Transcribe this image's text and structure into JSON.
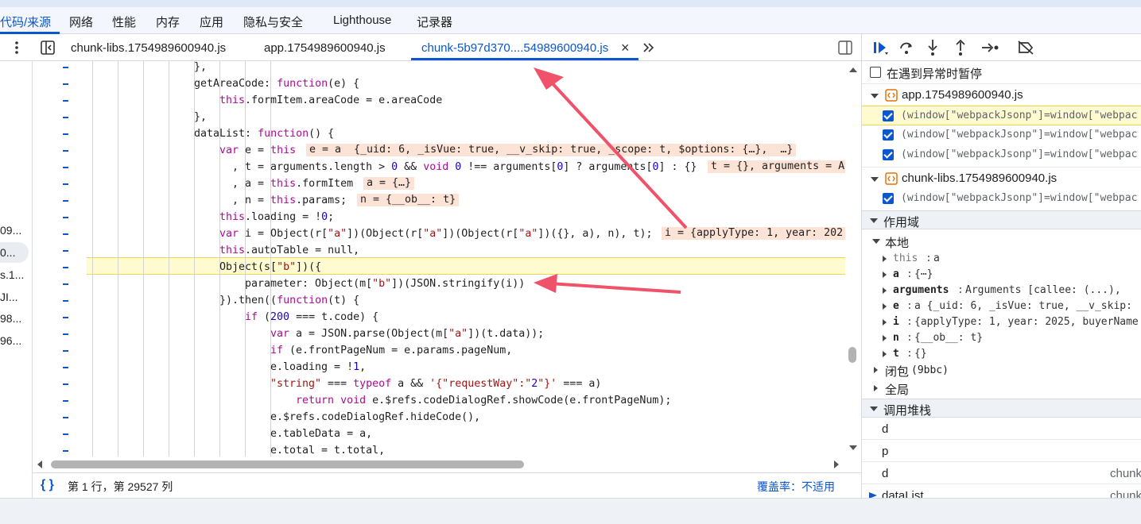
{
  "main_tabs": [
    {
      "label": "代码/来源",
      "active": true
    },
    {
      "label": "网络"
    },
    {
      "label": "性能"
    },
    {
      "label": "内存"
    },
    {
      "label": "应用"
    },
    {
      "label": "隐私与安全"
    },
    {
      "label": "Lighthouse"
    },
    {
      "label": "记录器"
    }
  ],
  "file_tabs": [
    {
      "label": "chunk-libs.1754989600940.js"
    },
    {
      "label": "app.1754989600940.js"
    },
    {
      "label": "chunk-5b97d370....54989600940.js",
      "active": true
    }
  ],
  "left_panel_items": [
    "09...",
    "0...",
    "s.1...",
    "JI...",
    "98...",
    "96..."
  ],
  "code_lines": [
    {
      "indent": 0,
      "html": "},"
    },
    {
      "indent": 0,
      "text": "getAreaCode: function(e) {"
    },
    {
      "indent": 1,
      "text": "this.formItem.areaCode = e.areaCode"
    },
    {
      "indent": 0,
      "text": "},"
    },
    {
      "indent": 0,
      "text": "dataList: function() {"
    },
    {
      "indent": 1,
      "text": "var e = this"
    },
    {
      "indent": 1,
      "text": "  , t = arguments.length > 0 && void 0 !== arguments[0] ? arguments[0] : {}"
    },
    {
      "indent": 1,
      "text": "  , a = this.formItem"
    },
    {
      "indent": 1,
      "text": "  , n = this.params;"
    },
    {
      "indent": 1,
      "text": "this.loading = !0;"
    },
    {
      "indent": 1,
      "text": "var i = Object(r[\"a\"])(Object(r[\"a\"])(Object(r[\"a\"])({}, a), n), t);"
    },
    {
      "indent": 1,
      "text": "this.autoTable = null,"
    },
    {
      "indent": 1,
      "text": "Object(s[\"b\"])({"
    },
    {
      "indent": 2,
      "text": "parameter: Object(m[\"b\"])(JSON.stringify(i))"
    },
    {
      "indent": 1,
      "text": "}).then((function(t) {"
    },
    {
      "indent": 2,
      "text": "if (200 === t.code) {"
    },
    {
      "indent": 3,
      "text": "var a = JSON.parse(Object(m[\"a\"])(t.data));"
    },
    {
      "indent": 3,
      "text": "if (e.frontPageNum = e.params.pageNum,"
    },
    {
      "indent": 3,
      "text": "e.loading = !1,"
    },
    {
      "indent": 3,
      "text": "\"string\" === typeof a && '{\"requestWay\":\"2\"}' === a)"
    },
    {
      "indent": 4,
      "text": "return void e.$refs.codeDialogRef.showCode(e.frontPageNum);"
    },
    {
      "indent": 3,
      "text": "e.$refs.codeDialogRef.hideCode(),"
    },
    {
      "indent": 3,
      "text": "e.tableData = a,"
    },
    {
      "indent": 3,
      "text": "e.total = t.total,"
    }
  ],
  "inline_values": [
    "e = a  {_uid: 6, _isVue: true, __v_skip: true, _scope: t, $options: {…},  …}",
    "t = {}, arguments = A",
    "a = {…}",
    "n = {__ob__: t}",
    "i = {applyType: 1, year: 202"
  ],
  "status": {
    "position": "第 1 行，第 29527 列",
    "coverage": "覆盖率：不适用"
  },
  "right": {
    "pause_on_exception": "在遇到异常时暂停",
    "breakpoint_files": [
      {
        "file": "app.1754989600940.js",
        "items": [
          "(window[\"webpackJsonp\"]=window[\"webpac",
          "(window[\"webpackJsonp\"]=window[\"webpac",
          "(window[\"webpackJsonp\"]=window[\"webpac"
        ]
      },
      {
        "file": "chunk-libs.1754989600940.js",
        "items": [
          "(window[\"webpackJsonp\"]=window[\"webpac"
        ]
      }
    ],
    "scope_title": "作用域",
    "local_title": "本地",
    "scope_vars": [
      {
        "name": "this",
        "value": "a",
        "dim": true
      },
      {
        "name": "a",
        "value": "{⋯}"
      },
      {
        "name": "arguments",
        "value": "Arguments  [callee: (...),"
      },
      {
        "name": "e",
        "value": "a  {_uid: 6, _isVue: true, __v_skip:"
      },
      {
        "name": "i",
        "value": "{applyType: 1, year: 2025, buyerName"
      },
      {
        "name": "n",
        "value": "{__ob__: t}"
      },
      {
        "name": "t",
        "value": "{}"
      }
    ],
    "closure_label": "闭包",
    "closure_suffix": "(9bbc)",
    "global_label": "全局",
    "callstack_title": "调用堆栈",
    "callstack": [
      {
        "fn": "d",
        "src": ""
      },
      {
        "fn": "p",
        "src": ""
      },
      {
        "fn": "d",
        "src": "chunk"
      },
      {
        "fn": "dataList",
        "src": "chunk"
      }
    ]
  },
  "colors": {
    "accent": "#0b57d0",
    "arrow": "#f0526a",
    "highlight": "#fffbd0",
    "inline_bg": "#fde3d6"
  }
}
